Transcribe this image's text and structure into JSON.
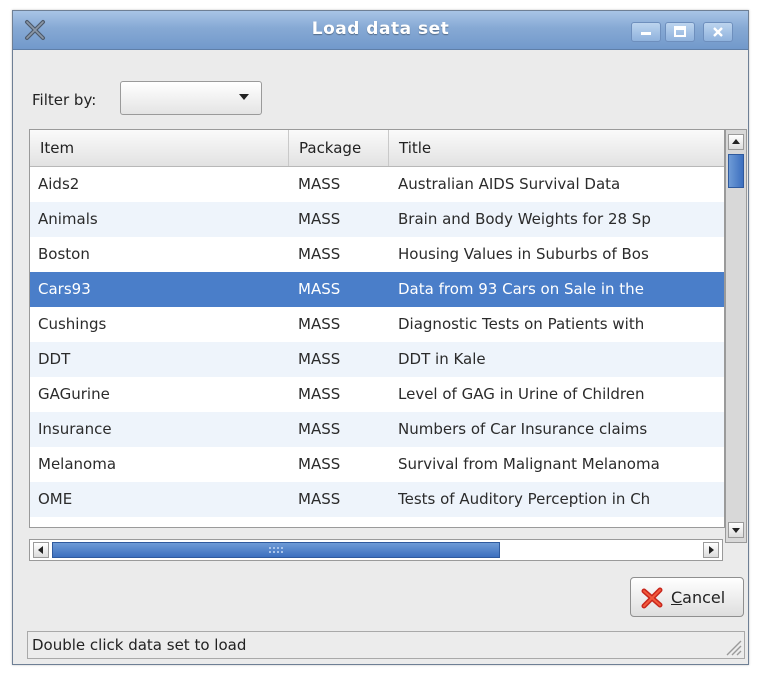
{
  "window": {
    "title": "Load data set"
  },
  "filter": {
    "label": "Filter by:",
    "value": ""
  },
  "table": {
    "columns": [
      "Item",
      "Package",
      "Title"
    ],
    "rows": [
      {
        "item": "Aids2",
        "package": "MASS",
        "title": "Australian AIDS Survival Data"
      },
      {
        "item": "Animals",
        "package": "MASS",
        "title": "Brain and Body Weights for 28 Sp"
      },
      {
        "item": "Boston",
        "package": "MASS",
        "title": "Housing Values in Suburbs of Bos"
      },
      {
        "item": "Cars93",
        "package": "MASS",
        "title": "Data from 93 Cars on Sale in the",
        "selected": true
      },
      {
        "item": "Cushings",
        "package": "MASS",
        "title": "Diagnostic Tests on Patients with"
      },
      {
        "item": "DDT",
        "package": "MASS",
        "title": "DDT in Kale"
      },
      {
        "item": "GAGurine",
        "package": "MASS",
        "title": "Level of GAG in Urine of Children"
      },
      {
        "item": "Insurance",
        "package": "MASS",
        "title": "Numbers of Car Insurance claims"
      },
      {
        "item": "Melanoma",
        "package": "MASS",
        "title": "Survival from Malignant Melanoma"
      },
      {
        "item": "OME",
        "package": "MASS",
        "title": "Tests of Auditory Perception in Ch"
      }
    ]
  },
  "buttons": {
    "cancel_mnemonic": "C",
    "cancel_rest": "ancel"
  },
  "status": {
    "text": "Double click data set to load"
  },
  "icons": {
    "app": "x-app-icon",
    "minimize": "minimize-icon",
    "maximize": "maximize-icon",
    "close": "close-icon",
    "cancel": "red-x-icon"
  },
  "colors": {
    "titlebar": "#7299cb",
    "selection": "#4a7ec9",
    "scroll_thumb": "#3c6fbf",
    "alt_row": "#eef4fb"
  }
}
